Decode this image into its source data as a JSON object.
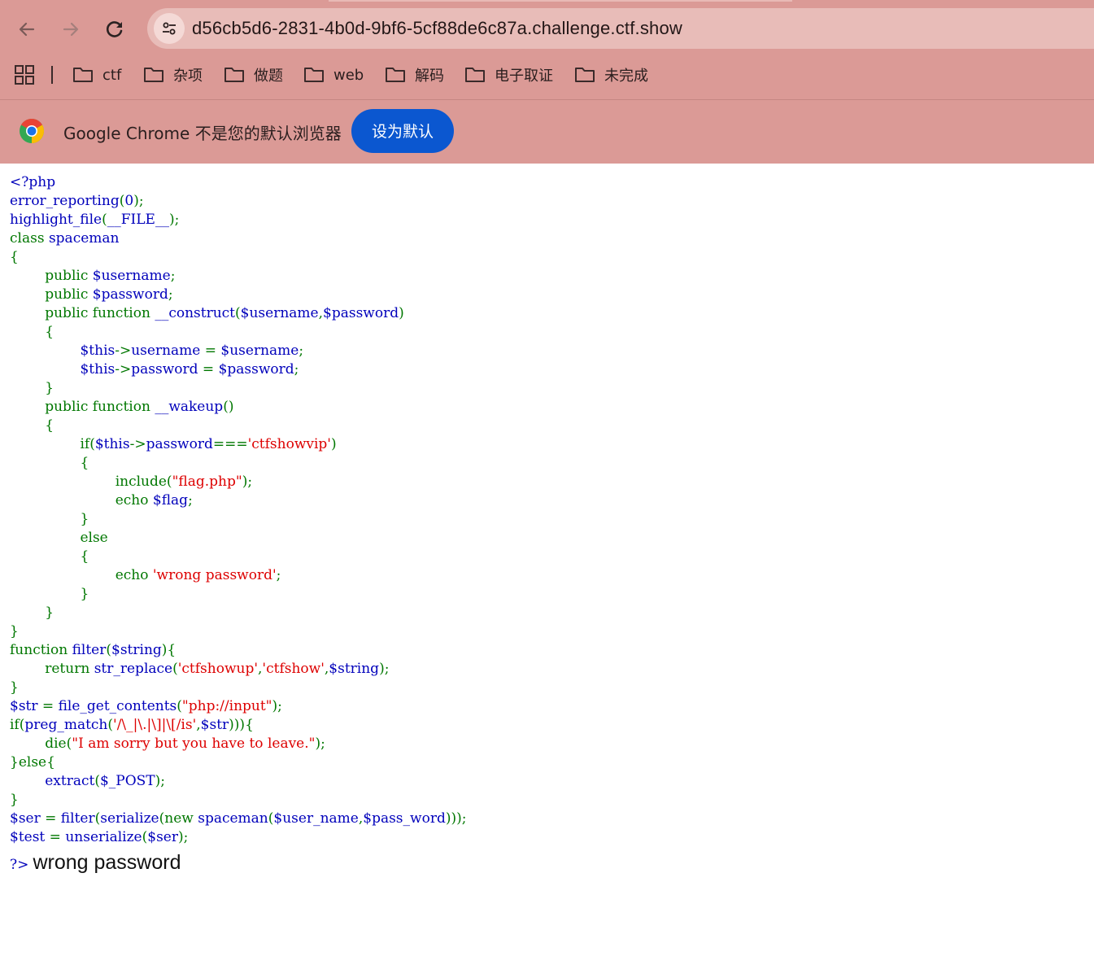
{
  "browser": {
    "url": "d56cb5d6-2831-4b0d-9bf6-5cf88de6c87a.challenge.ctf.show",
    "back_icon": "arrow-left-icon",
    "forward_icon": "arrow-right-icon",
    "reload_icon": "reload-icon",
    "site_info_icon": "tune-icon",
    "bookmarks": [
      "ctf",
      "杂项",
      "做题",
      "web",
      "解码",
      "电子取证",
      "未完成"
    ],
    "infobar": {
      "message": "Google Chrome 不是您的默认浏览器",
      "button": "设为默认"
    },
    "colors": {
      "chrome_bg": "#db9a96",
      "button": "#0b57d0"
    }
  },
  "page": {
    "code_lines": [
      [
        [
          "d",
          "<?php"
        ]
      ],
      [
        [
          "d",
          "error_reporting"
        ],
        [
          "k",
          "("
        ],
        [
          "d",
          "0"
        ],
        [
          "k",
          ");"
        ]
      ],
      [
        [
          "d",
          "highlight_file"
        ],
        [
          "k",
          "("
        ],
        [
          "d",
          "__FILE__"
        ],
        [
          "k",
          ");"
        ]
      ],
      [
        [
          "k",
          "class "
        ],
        [
          "d",
          "spaceman"
        ]
      ],
      [
        [
          "k",
          "{"
        ]
      ],
      [
        [
          "k",
          "        public "
        ],
        [
          "d",
          "$username"
        ],
        [
          "k",
          ";"
        ]
      ],
      [
        [
          "k",
          "        public "
        ],
        [
          "d",
          "$password"
        ],
        [
          "k",
          ";"
        ]
      ],
      [
        [
          "k",
          "        public function "
        ],
        [
          "d",
          "__construct"
        ],
        [
          "k",
          "("
        ],
        [
          "d",
          "$username"
        ],
        [
          "k",
          ","
        ],
        [
          "d",
          "$password"
        ],
        [
          "k",
          ")"
        ]
      ],
      [
        [
          "k",
          "        {"
        ]
      ],
      [
        [
          "k",
          "                "
        ],
        [
          "d",
          "$this"
        ],
        [
          "k",
          "->"
        ],
        [
          "d",
          "username "
        ],
        [
          "k",
          "= "
        ],
        [
          "d",
          "$username"
        ],
        [
          "k",
          ";"
        ]
      ],
      [
        [
          "k",
          "                "
        ],
        [
          "d",
          "$this"
        ],
        [
          "k",
          "->"
        ],
        [
          "d",
          "password "
        ],
        [
          "k",
          "= "
        ],
        [
          "d",
          "$password"
        ],
        [
          "k",
          ";"
        ]
      ],
      [
        [
          "k",
          "        }"
        ]
      ],
      [
        [
          "k",
          "        public function "
        ],
        [
          "d",
          "__wakeup"
        ],
        [
          "k",
          "()"
        ]
      ],
      [
        [
          "k",
          "        {"
        ]
      ],
      [
        [
          "k",
          "                if("
        ],
        [
          "d",
          "$this"
        ],
        [
          "k",
          "->"
        ],
        [
          "d",
          "password"
        ],
        [
          "k",
          "==="
        ],
        [
          "s",
          "'ctfshowvip'"
        ],
        [
          "k",
          ")"
        ]
      ],
      [
        [
          "k",
          "                {"
        ]
      ],
      [
        [
          "k",
          "                        include("
        ],
        [
          "s",
          "\"flag.php\""
        ],
        [
          "k",
          ");"
        ]
      ],
      [
        [
          "k",
          "                        echo "
        ],
        [
          "d",
          "$flag"
        ],
        [
          "k",
          ";"
        ]
      ],
      [
        [
          "k",
          "                }"
        ]
      ],
      [
        [
          "k",
          "                else"
        ]
      ],
      [
        [
          "k",
          "                {"
        ]
      ],
      [
        [
          "k",
          "                        echo "
        ],
        [
          "s",
          "'wrong password'"
        ],
        [
          "k",
          ";"
        ]
      ],
      [
        [
          "k",
          "                }"
        ]
      ],
      [
        [
          "k",
          "        }"
        ]
      ],
      [
        [
          "k",
          "}"
        ]
      ],
      [
        [
          "k",
          "function "
        ],
        [
          "d",
          "filter"
        ],
        [
          "k",
          "("
        ],
        [
          "d",
          "$string"
        ],
        [
          "k",
          "){"
        ]
      ],
      [
        [
          "k",
          "        return "
        ],
        [
          "d",
          "str_replace"
        ],
        [
          "k",
          "("
        ],
        [
          "s",
          "'ctfshowup'"
        ],
        [
          "k",
          ","
        ],
        [
          "s",
          "'ctfshow'"
        ],
        [
          "k",
          ","
        ],
        [
          "d",
          "$string"
        ],
        [
          "k",
          ");"
        ]
      ],
      [
        [
          "k",
          "}"
        ]
      ],
      [
        [
          "d",
          "$str "
        ],
        [
          "k",
          "= "
        ],
        [
          "d",
          "file_get_contents"
        ],
        [
          "k",
          "("
        ],
        [
          "s",
          "\"php://input\""
        ],
        [
          "k",
          ");"
        ]
      ],
      [
        [
          "k",
          "if("
        ],
        [
          "d",
          "preg_match"
        ],
        [
          "k",
          "("
        ],
        [
          "s",
          "'/\\_|\\.|\\]|\\[/is'"
        ],
        [
          "k",
          ","
        ],
        [
          "d",
          "$str"
        ],
        [
          "k",
          "))){"
        ]
      ],
      [
        [
          "k",
          "        die("
        ],
        [
          "s",
          "\"I am sorry but you have to leave.\""
        ],
        [
          "k",
          ");"
        ]
      ],
      [
        [
          "k",
          "}else{"
        ]
      ],
      [
        [
          "k",
          "        "
        ],
        [
          "d",
          "extract"
        ],
        [
          "k",
          "("
        ],
        [
          "d",
          "$_POST"
        ],
        [
          "k",
          ");"
        ]
      ],
      [
        [
          "k",
          "}"
        ]
      ],
      [
        [
          "d",
          "$ser "
        ],
        [
          "k",
          "= "
        ],
        [
          "d",
          "filter"
        ],
        [
          "k",
          "("
        ],
        [
          "d",
          "serialize"
        ],
        [
          "k",
          "(new "
        ],
        [
          "d",
          "spaceman"
        ],
        [
          "k",
          "("
        ],
        [
          "d",
          "$user_name"
        ],
        [
          "k",
          ","
        ],
        [
          "d",
          "$pass_word"
        ],
        [
          "k",
          ")));"
        ]
      ],
      [
        [
          "d",
          "$test "
        ],
        [
          "k",
          "= "
        ],
        [
          "d",
          "unserialize"
        ],
        [
          "k",
          "("
        ],
        [
          "d",
          "$ser"
        ],
        [
          "k",
          ");"
        ]
      ]
    ],
    "closing_tag": "?>",
    "output_text": "wrong password",
    "colors": {
      "default": "#0000bb",
      "keyword": "#007700",
      "string": "#dd0000"
    }
  }
}
